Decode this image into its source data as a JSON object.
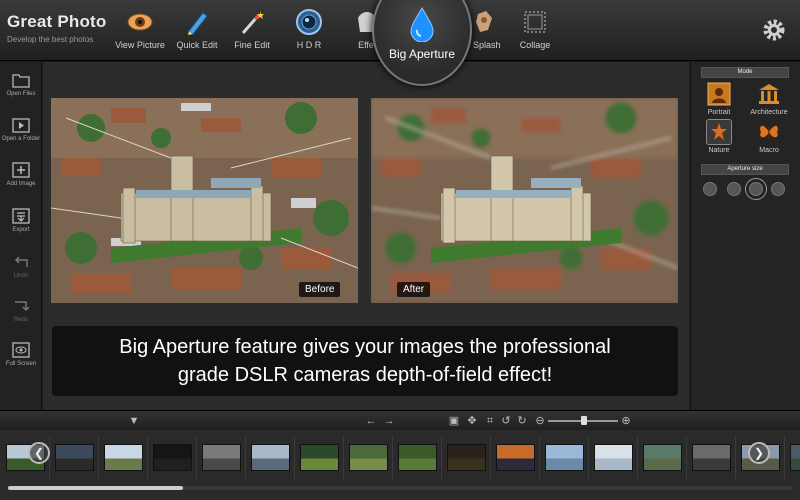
{
  "app": {
    "title": "Great Photo",
    "subtitle": "Develop the best photos"
  },
  "toolbar": {
    "items": [
      {
        "label": "View Picture",
        "icon": "eye-icon"
      },
      {
        "label": "Quick Edit",
        "icon": "pencil-icon"
      },
      {
        "label": "Fine Edit",
        "icon": "magic-wand-icon"
      },
      {
        "label": "H D R",
        "icon": "lens-icon"
      },
      {
        "label": "Effe",
        "icon": "effects-icon"
      },
      {
        "label": "r Splash",
        "icon": "splash-icon"
      },
      {
        "label": "Collage",
        "icon": "collage-icon"
      }
    ],
    "active": {
      "label": "Big Aperture",
      "icon": "water-drop-icon"
    },
    "settings_icon": "gear-icon"
  },
  "sidebar": {
    "items": [
      {
        "label": "Open Files",
        "icon": "folder-icon",
        "enabled": true
      },
      {
        "label": "Open a Folder",
        "icon": "folder-play-icon",
        "enabled": true
      },
      {
        "label": "Add Image",
        "icon": "add-image-icon",
        "enabled": true
      },
      {
        "label": "Export",
        "icon": "export-icon",
        "enabled": true
      },
      {
        "label": "Undo",
        "icon": "undo-icon",
        "enabled": false
      },
      {
        "label": "Redo",
        "icon": "redo-icon",
        "enabled": false
      },
      {
        "label": "Full Screen",
        "icon": "eye-icon",
        "enabled": true
      }
    ]
  },
  "canvas": {
    "before_label": "Before",
    "after_label": "After",
    "caption_line1": "Big Aperture feature gives your images the professional",
    "caption_line2": "grade DSLR cameras depth-of-field effect!"
  },
  "right_panel": {
    "mode_header": "Mode",
    "modes": [
      {
        "label": "Portrait",
        "icon": "portrait-icon"
      },
      {
        "label": "Architecture",
        "icon": "architecture-icon"
      },
      {
        "label": "Nature",
        "icon": "nature-icon",
        "selected": true
      },
      {
        "label": "Macro",
        "icon": "butterfly-icon"
      }
    ],
    "aperture_header": "Aperture size",
    "aperture_selected_index": 3
  },
  "colors": {
    "accent": "#1e90ff",
    "background": "#1b1b1b",
    "panel": "#2c2c2c"
  }
}
